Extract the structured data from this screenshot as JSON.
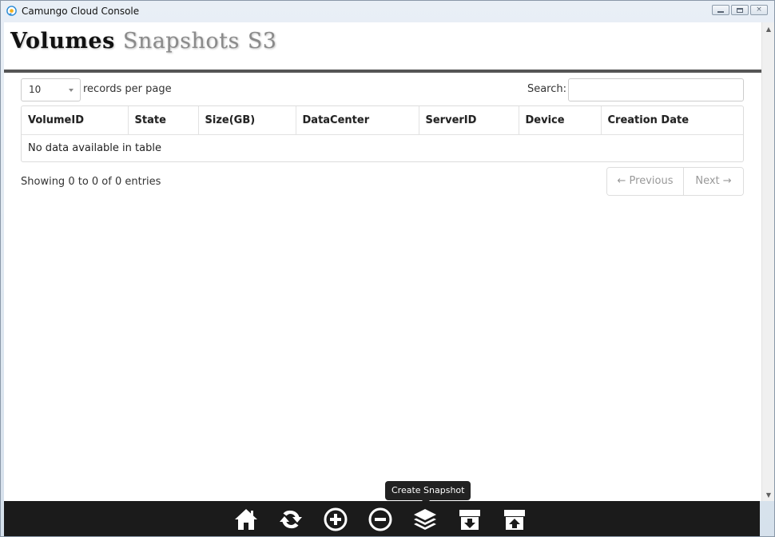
{
  "window": {
    "title": "Camungo Cloud Console",
    "close_glyph": "×"
  },
  "header": {
    "tabs": [
      {
        "label": "Volumes",
        "active": true
      },
      {
        "label": "Snapshots",
        "active": false
      },
      {
        "label": "S3",
        "active": false
      }
    ]
  },
  "table_controls": {
    "length_value": "10",
    "length_label": "records per page",
    "search_label": "Search:",
    "search_value": ""
  },
  "table": {
    "columns": [
      "VolumeID",
      "State",
      "Size(GB)",
      "DataCenter",
      "ServerID",
      "Device",
      "Creation Date"
    ],
    "empty_message": "No data available in table"
  },
  "footer": {
    "info": "Showing 0 to 0 of 0 entries",
    "previous_label": "← Previous",
    "next_label": "Next →"
  },
  "tooltip": {
    "text": "Create Snapshot"
  },
  "toolbar": {
    "buttons": [
      {
        "name": "home",
        "icon": "home-icon"
      },
      {
        "name": "refresh",
        "icon": "refresh-icon"
      },
      {
        "name": "add",
        "icon": "plus-circle-icon"
      },
      {
        "name": "remove",
        "icon": "minus-circle-icon"
      },
      {
        "name": "create-snapshot",
        "icon": "layers-icon"
      },
      {
        "name": "download",
        "icon": "box-download-icon"
      },
      {
        "name": "upload",
        "icon": "box-upload-icon"
      }
    ]
  },
  "colors": {
    "toolbar_bg": "#1b1b1b",
    "header_rule": "#555555",
    "inactive_tab": "#8a8a8a"
  }
}
